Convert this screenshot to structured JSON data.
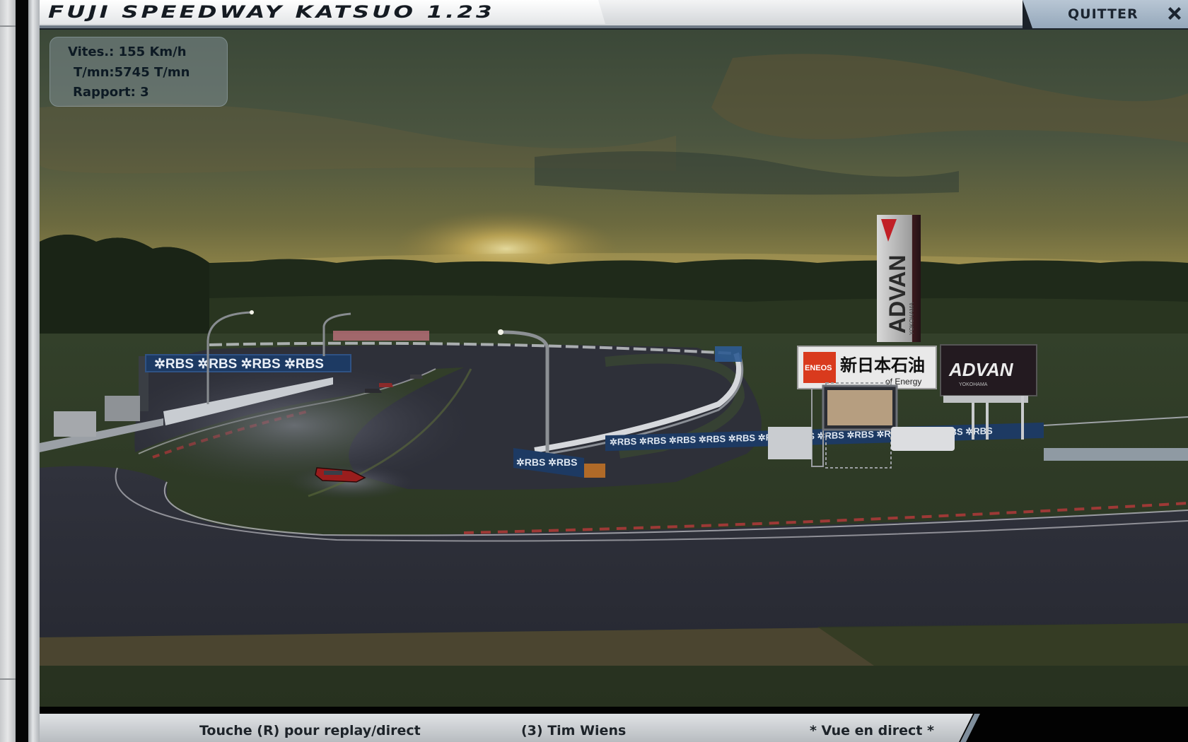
{
  "window": {
    "title": "FUJI SPEEDWAY KATSUO 1.23",
    "quit_label": "QUITTER",
    "close_icon": "close-x-icon"
  },
  "hud": {
    "speed": "Vites.: 155 Km/h",
    "rpm": "T/mn:5745 T/mn",
    "gear": "Rapport: 3"
  },
  "status_bar": {
    "hint": "Touche (R) pour replay/direct",
    "driver": "(3) Tim Wiens",
    "view_mode": "* Vue en direct *"
  },
  "scene": {
    "banners": {
      "rbs_gantry": "✲RBS ✲RBS ✲RBS ✲RBS",
      "rbs_barrier": "✲RBS ✲RBS ✲RBS ✲RBS ✲RBS ✲RBS ✲RBS ✲RBS ✲RBS ✲RBS ✲RBS ✲RBS ✲RBS",
      "rbs_barrier_left": "✲RBS ✲RBS",
      "advan_tower": "ADVAN",
      "yokohama": "YOKOHAMA",
      "eneos_logo": "ENEOS",
      "eneos_jp": "新日本石油",
      "eneos_tagline": "of Energy",
      "advan_board": "ADVAN",
      "advan_board_sub": "YOKOHAMA"
    },
    "colors": {
      "sky_top": "#3c4a37",
      "sky_glow": "#d9c36a",
      "asphalt": "#2c2e37",
      "grass": "#2f3a22",
      "rbs_blue": "#1d3a63",
      "car_red": "#9a1d1d"
    }
  }
}
